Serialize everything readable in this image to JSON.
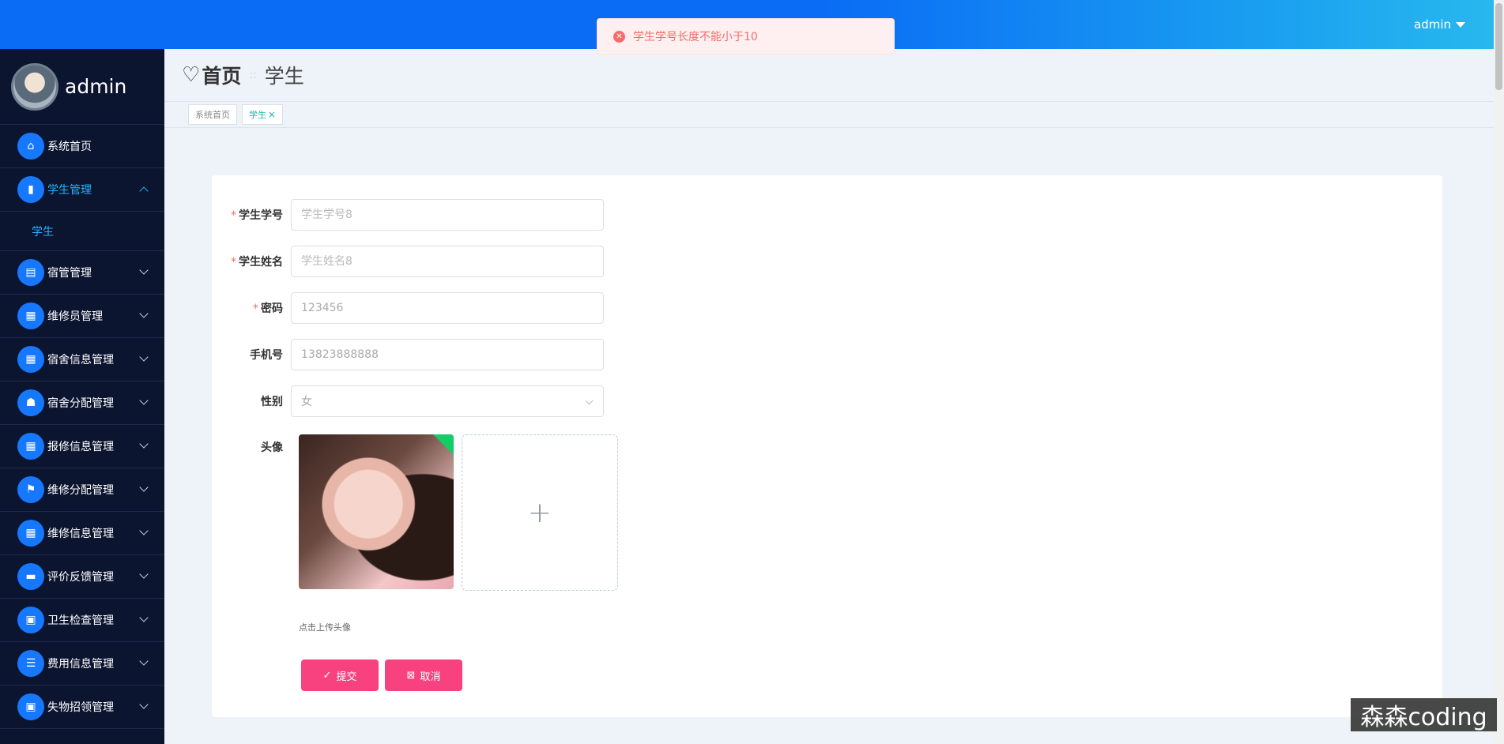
{
  "topbar": {
    "user": "admin"
  },
  "toast": {
    "message": "学生学号长度不能小于10"
  },
  "sidebar": {
    "profile_name": "admin",
    "items": [
      {
        "label": "系统首页",
        "icon": "home-icon"
      },
      {
        "label": "学生管理",
        "icon": "chart-icon",
        "active": true,
        "sub": "学生"
      },
      {
        "label": "宿管管理",
        "icon": "chart-icon"
      },
      {
        "label": "维修员管理",
        "icon": "grid-icon"
      },
      {
        "label": "宿舍信息管理",
        "icon": "grid-icon"
      },
      {
        "label": "宿舍分配管理",
        "icon": "thumb-icon"
      },
      {
        "label": "报修信息管理",
        "icon": "grid-icon"
      },
      {
        "label": "维修分配管理",
        "icon": "flag-icon"
      },
      {
        "label": "维修信息管理",
        "icon": "grid-icon"
      },
      {
        "label": "评价反馈管理",
        "icon": "ticket-icon"
      },
      {
        "label": "卫生检查管理",
        "icon": "clipboard-icon"
      },
      {
        "label": "费用信息管理",
        "icon": "list-icon"
      },
      {
        "label": "失物招领管理",
        "icon": "clipboard-icon"
      }
    ]
  },
  "breadcrumb": {
    "home": "首页",
    "current": "学生"
  },
  "tags": {
    "home": "系统首页",
    "current": "学生"
  },
  "form": {
    "student_id": {
      "label": "学生学号",
      "placeholder": "学生学号8"
    },
    "student_name": {
      "label": "学生姓名",
      "placeholder": "学生姓名8"
    },
    "password": {
      "label": "密码",
      "value": "123456"
    },
    "phone": {
      "label": "手机号",
      "value": "13823888888"
    },
    "gender": {
      "label": "性别",
      "value": "女"
    },
    "avatar": {
      "label": "头像",
      "hint": "点击上传头像"
    },
    "submit_label": "提交",
    "cancel_label": "取消"
  },
  "watermark": "森森coding",
  "colors": {
    "primary": "#0a6cf5",
    "sidebar": "#0c1530",
    "accent": "#f7427f",
    "error": "#f56c6c"
  }
}
